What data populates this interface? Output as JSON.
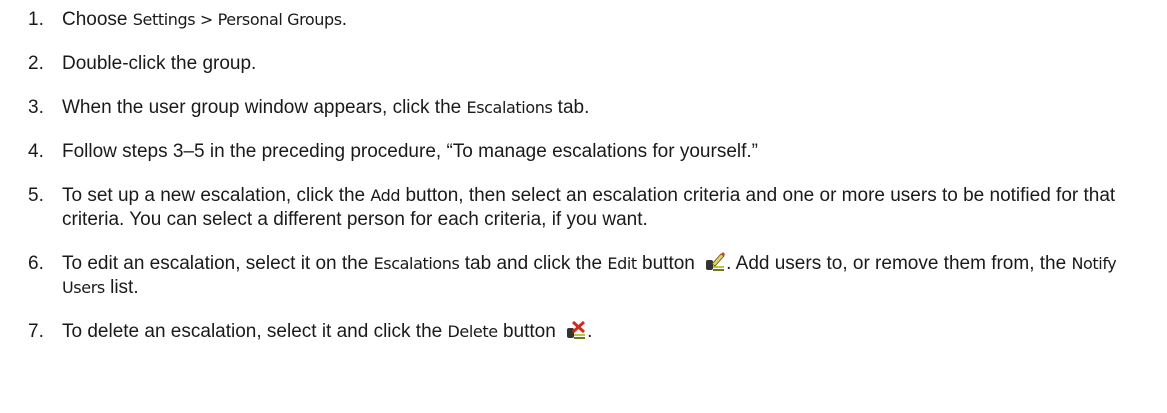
{
  "steps": [
    {
      "num": "1.",
      "t1": "Choose ",
      "ui1": "Settings > Personal Groups",
      "t2": "."
    },
    {
      "num": "2.",
      "t1": "Double-click the group."
    },
    {
      "num": "3.",
      "t1": "When the user group window appears, click the ",
      "ui1": "Escalations",
      "t2": " tab."
    },
    {
      "num": "4.",
      "t1": "Follow steps 3–5 in the preceding procedure, “To manage escalations for yourself.”"
    },
    {
      "num": "5.",
      "t1": "To set up a new escalation, click the ",
      "ui1": "Add",
      "t2": " button, then select an escalation criteria and one or more users to be notified for that criteria. You can select a different person for each criteria, if you want."
    },
    {
      "num": "6.",
      "t1": "To edit an escalation, select it on the ",
      "ui1": "Escalations",
      "t2": " tab and click the ",
      "ui2": "Edit",
      "t3": " button ",
      "icon": "edit-icon",
      "t4": ". Add users to, or remove them from, the ",
      "ui3": "Notify Users",
      "t5": " list."
    },
    {
      "num": "7.",
      "t1": "To delete an escalation, select it and click the ",
      "ui1": "Delete",
      "t2": " button ",
      "icon": "delete-icon",
      "t3": "."
    }
  ]
}
